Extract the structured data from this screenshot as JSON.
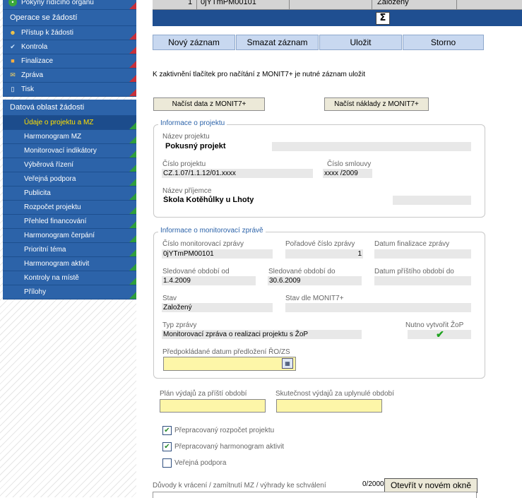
{
  "sidebar": {
    "top_item": "Pokyny řídícího orgánu",
    "section1_header": "Operace se žádostí",
    "section1_items": [
      {
        "label": "Přístup k žádosti",
        "icon": "people-icon"
      },
      {
        "label": "Kontrola",
        "icon": "checkmark-icon"
      },
      {
        "label": "Finalizace",
        "icon": "lock-icon"
      },
      {
        "label": "Zpráva",
        "icon": "envelope-icon"
      },
      {
        "label": "Tisk",
        "icon": "document-icon"
      }
    ],
    "section2_header": "Datová oblast žádosti",
    "section2_items": [
      "Údaje o projektu a MZ",
      "Harmonogram MZ",
      "Monitorovací indikátory",
      "Výběrová řízení",
      "Veřejná podpora",
      "Publicita",
      "Rozpočet projektu",
      "Přehled financování",
      "Harmonogram čerpání",
      "Prioritní téma",
      "Harmonogram aktivit",
      "Kontroly na místě",
      "Přílohy"
    ]
  },
  "table_row": {
    "num": "1",
    "code": "0jYTmPM00101",
    "status": "Založený"
  },
  "sum_icon": "Σ",
  "buttons": {
    "new": "Nový záznam",
    "delete": "Smazat záznam",
    "save": "Uložit",
    "cancel": "Storno"
  },
  "notice": "K zaktivnění tlačítek pro načítání z MONIT7+ je nutné záznam uložit",
  "load_buttons": {
    "data": "Načíst data z MONIT7+",
    "costs": "Načíst náklady z MONIT7+"
  },
  "project_info": {
    "legend": "Informace o projektu",
    "name_label": "Název projektu",
    "name_value": "Pokusný projekt",
    "number_label": "Číslo projektu",
    "number_value": "CZ.1.07/1.1.12/01.xxxx",
    "contract_label": "Číslo smlouvy",
    "contract_value": "xxxx /2009",
    "recipient_label": "Název příjemce",
    "recipient_value": "Škola Kotěhůlky u Lhoty"
  },
  "report_info": {
    "legend": "Informace o monitorovací zprávě",
    "report_no_label": "Číslo monitorovací zprávy",
    "report_no_value": "0jYTmPM00101",
    "order_label": "Pořadové číslo zprávy",
    "order_value": "1",
    "final_date_label": "Datum finalizace zprávy",
    "final_date_value": "",
    "from_label": "Sledované období od",
    "from_value": "1.4.2009",
    "to_label": "Sledované období do",
    "to_value": "30.6.2009",
    "next_label": "Datum příštího období do",
    "next_value": "",
    "state_label": "Stav",
    "state_value": "Založený",
    "monit_state_label": "Stav dle MONIT7+",
    "monit_state_value": "",
    "type_label": "Typ zprávy",
    "type_value": "Monitorovací zpráva o realizaci projektu s ŽoP",
    "zop_label": "Nutno vytvořit ŽoP",
    "submit_label": "Předpokládané datum předložení ŘO/ZS"
  },
  "plan": {
    "plan_label": "Plán výdajů za příští období",
    "actual_label": "Skutečnost výdajů za uplynulé období"
  },
  "checkboxes": [
    {
      "label": "Přepracovaný rozpočet projektu",
      "checked": true
    },
    {
      "label": "Přepracovaný harmonogram aktivit",
      "checked": true
    },
    {
      "label": "Veřejná podpora",
      "checked": false
    }
  ],
  "reasons_label": "Důvody k vrácení / zamítnutí MZ / výhrady ke schválení",
  "char_count": "0/2000",
  "open_window_button": "Otevřít v novém okně",
  "colors": {
    "nav_bg": "#2c63a9",
    "active_text": "#ffe000",
    "input_yellow": "#fdf6a8",
    "button_blue": "#c8d8f0"
  }
}
